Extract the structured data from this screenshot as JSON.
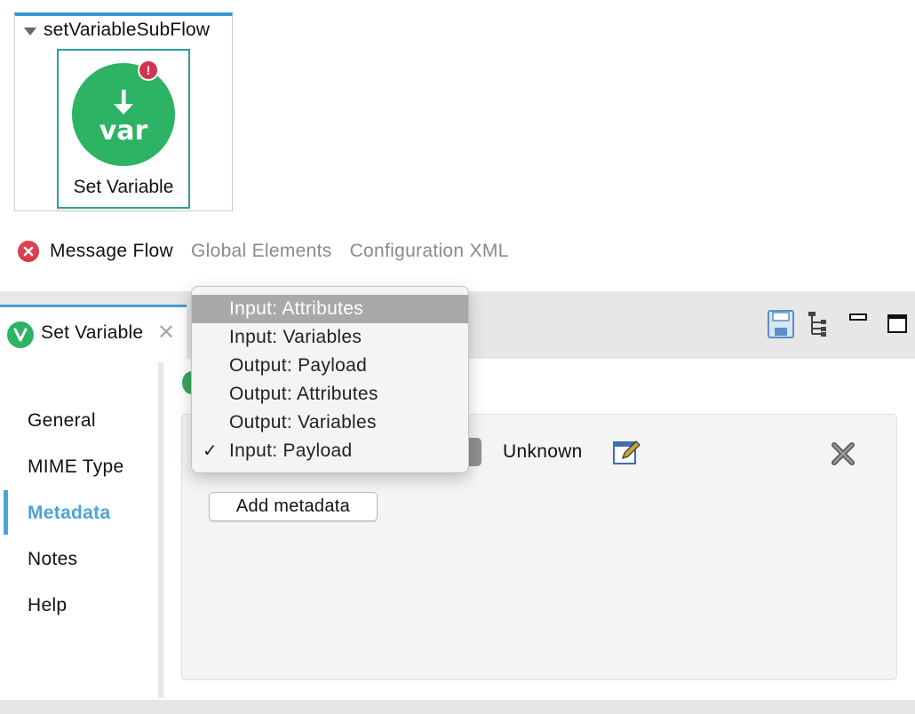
{
  "canvas": {
    "subflow_title": "setVariableSubFlow",
    "processor": {
      "icon_text": "var",
      "label": "Set Variable",
      "error_mark": "!"
    }
  },
  "editor_tabs": [
    {
      "label": "Message Flow",
      "active": true
    },
    {
      "label": "Global Elements",
      "active": false
    },
    {
      "label": "Configuration XML",
      "active": false
    }
  ],
  "properties_view": {
    "tab_title": "Set Variable",
    "tab_close": "✕",
    "nav": [
      {
        "label": "General",
        "active": false
      },
      {
        "label": "MIME Type",
        "active": false
      },
      {
        "label": "Metadata",
        "active": true
      },
      {
        "label": "Notes",
        "active": false
      },
      {
        "label": "Help",
        "active": false
      }
    ],
    "metadata": {
      "type_value": "Unknown",
      "add_button": "Add metadata"
    },
    "toolbar_icons": [
      "save-icon",
      "tree-icon",
      "minimize-icon",
      "maximize-icon"
    ]
  },
  "dropdown": {
    "items": [
      {
        "label": "Input: Attributes",
        "highlighted": true,
        "checked": false
      },
      {
        "label": "Input: Variables",
        "highlighted": false,
        "checked": false
      },
      {
        "label": "Output: Payload",
        "highlighted": false,
        "checked": false
      },
      {
        "label": "Output: Attributes",
        "highlighted": false,
        "checked": false
      },
      {
        "label": "Output: Variables",
        "highlighted": false,
        "checked": false
      },
      {
        "label": "Input: Payload",
        "highlighted": false,
        "checked": true
      }
    ],
    "check_mark": "✓"
  },
  "colors": {
    "accent_blue": "#4aa3d9",
    "processor_green": "#2cb364",
    "error_red": "#d2334e",
    "menu_highlight": "#a9a9a9"
  }
}
